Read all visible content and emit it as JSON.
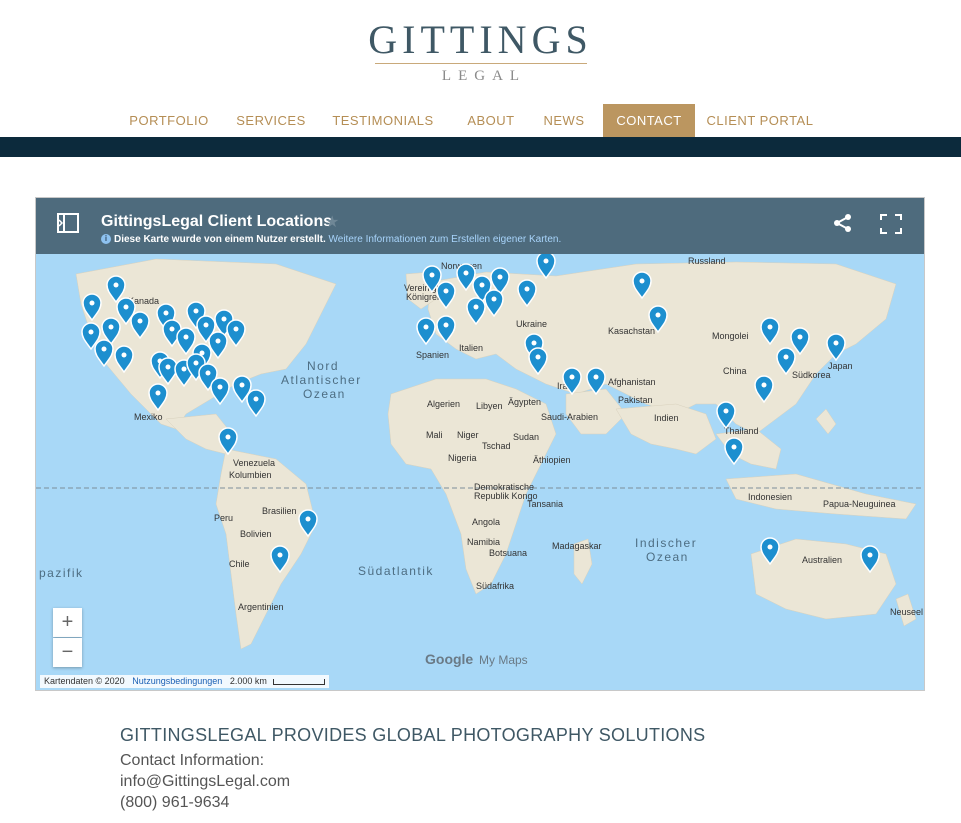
{
  "logo": {
    "main": "GITTINGS",
    "sub": "LEGAL"
  },
  "nav": [
    {
      "label": "PORTFOLIO",
      "active": false
    },
    {
      "label": "SERVICES",
      "active": false
    },
    {
      "label": "TESTIMONIALS",
      "active": false
    },
    {
      "label": "ABOUT",
      "active": false
    },
    {
      "label": "NEWS",
      "active": false
    },
    {
      "label": "CONTACT",
      "active": true
    },
    {
      "label": "CLIENT PORTAL",
      "active": false
    }
  ],
  "map": {
    "title": "GittingsLegal Client Locations",
    "info_text": "Diese Karte wurde von einem Nutzer erstellt.",
    "info_link": "Weitere Informationen zum Erstellen eigener Karten.",
    "labels": [
      "Norwegen",
      "Russland",
      "Kanada",
      "Ukraine",
      "Kasachstan",
      "Mongolei",
      "China",
      "Südkorea",
      "Japan",
      "Afghanistan",
      "Pakistan",
      "Indien",
      "Thailand",
      "Indonesien",
      "Papua-Neuguinea",
      "Australien",
      "Neuseel",
      "Saudi-Arabien",
      "Irak",
      "Ägypten",
      "Libyen",
      "Algerien",
      "Mali",
      "Niger",
      "Tschad",
      "Sudan",
      "Nigeria",
      "Äthiopien",
      "Demokratische",
      "Republik Kongo",
      "Tansania",
      "Angola",
      "Namibia",
      "Botsuana",
      "Madagaskar",
      "Südafrika",
      "Nord",
      "Atlantischer",
      "Ozean",
      "Südatlantik",
      "Indischer",
      "Ozean",
      "Venezuela",
      "Kolumbien",
      "Peru",
      "Brasilien",
      "Bolivien",
      "Chile",
      "Argentinien",
      "Spanien",
      "Italien",
      "Vereinigtes",
      "Königreich",
      "Mexiko",
      "pazifik"
    ],
    "attribution": "Kartendaten © 2020",
    "terms": "Nutzungsbedingungen",
    "scale": "2.000 km",
    "zoom_in": "+",
    "zoom_out": "−",
    "brand_google": "Google",
    "brand_mymaps": "My Maps",
    "colors": {
      "header": "#4e6b7d",
      "water": "#a8d8f7",
      "land": "#ebe6d6",
      "pin": "#1d8fcf"
    }
  },
  "footer": {
    "heading": "GITTINGSLEGAL PROVIDES GLOBAL PHOTOGRAPHY SOLUTIONS",
    "contact_label": "Contact Information:",
    "email": "info@GittingsLegal.com",
    "phone": "(800) 961-9634"
  }
}
